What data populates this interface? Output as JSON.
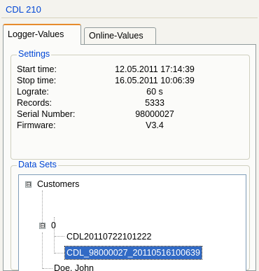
{
  "group": {
    "title": "CDL 210"
  },
  "tabs": [
    {
      "label": "Logger-Values",
      "active": true
    },
    {
      "label": "Online-Values",
      "active": false
    }
  ],
  "settings": {
    "legend": "Settings",
    "rows": [
      {
        "label": "Start time:",
        "value": "12.05.2011 17:14:39"
      },
      {
        "label": "Stop time:",
        "value": "16.05.2011 10:06:39"
      },
      {
        "label": "Lograte:",
        "value": "60 s"
      },
      {
        "label": "Records:",
        "value": "5333"
      },
      {
        "label": "Serial Number:",
        "value": "98000027"
      },
      {
        "label": "Firmware:",
        "value": "V3.4"
      }
    ]
  },
  "datasets": {
    "legend": "Data Sets",
    "tree": {
      "root": {
        "label": "Customers",
        "expander": "⊟"
      },
      "child": {
        "label": "0",
        "expander": "⊟"
      },
      "items": [
        {
          "label": "CDL20110722101222",
          "selected": false
        },
        {
          "label": "CDL_98000027_20110516100639",
          "selected": true
        }
      ],
      "sibling": {
        "label": "Doe, John"
      }
    }
  },
  "colors": {
    "accent": "#0046d5",
    "selection": "#316ac5",
    "tab_highlight": "#e68b2c"
  }
}
